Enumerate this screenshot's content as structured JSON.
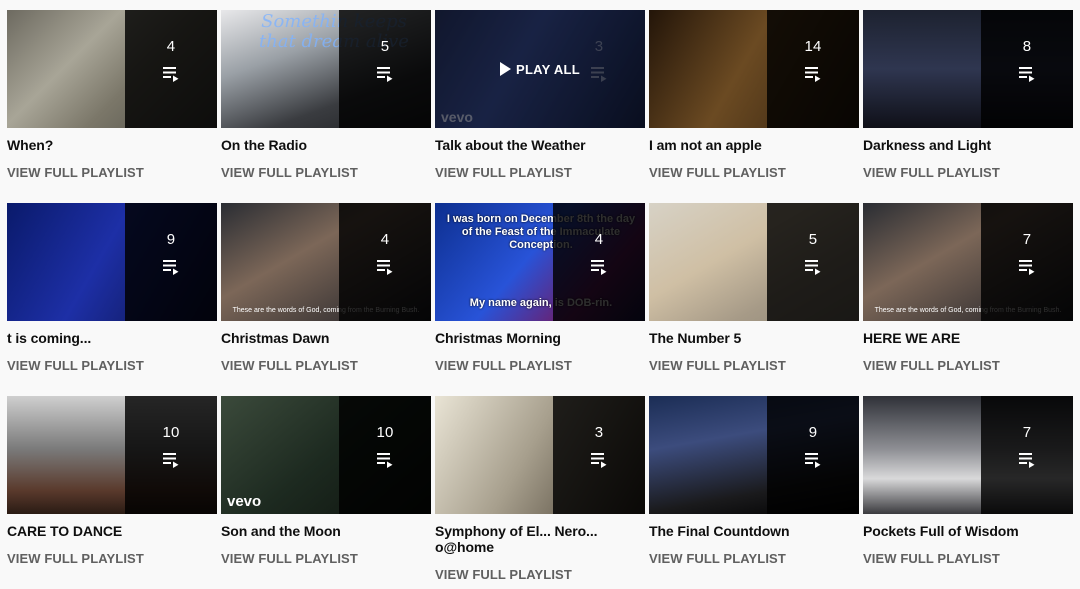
{
  "playlists": [
    {
      "title": "When?",
      "count": "4",
      "link": "VIEW FULL PLAYLIST",
      "bg": "linear-gradient(135deg,#6d6a60 0%,#a8a597 35%,#7b7769 60%,#4b4a44 100%)"
    },
    {
      "title": "On the Radio",
      "count": "5",
      "link": "VIEW FULL PLAYLIST",
      "bg": "linear-gradient(160deg,#e8e8ea 0%,#9aa0a6 35%,#3a3c40 70%,#1e1f22 100%)"
    },
    {
      "title": "Talk about the Weather",
      "count": "3",
      "link": "VIEW FULL PLAYLIST",
      "play_all": "PLAY ALL",
      "bg": "linear-gradient(120deg,#1f2a52 0%,#2d3f7c 40%,#111a38 100%)"
    },
    {
      "title": "I am not an apple",
      "count": "14",
      "link": "VIEW FULL PLAYLIST",
      "bg": "linear-gradient(120deg,#231509 0%,#6b4a22 45%,#30200f 100%)"
    },
    {
      "title": "Darkness and Light",
      "count": "8",
      "link": "VIEW FULL PLAYLIST",
      "bg": "linear-gradient(180deg,#1d2230 0%,#2f3650 50%,#0f1018 100%)"
    },
    {
      "title": "t is coming...",
      "count": "9",
      "link": "VIEW FULL PLAYLIST",
      "bg": "linear-gradient(120deg,#0a1a6b 0%,#1d2fa6 45%,#0b1040 100%)"
    },
    {
      "title": "Christmas Dawn",
      "count": "4",
      "link": "VIEW FULL PLAYLIST",
      "bg": "linear-gradient(150deg,#2a2d33 0%,#7c6758 40%,#1c1e25 100%)"
    },
    {
      "title": "Christmas Morning",
      "count": "4",
      "link": "VIEW FULL PLAYLIST",
      "bg": "linear-gradient(130deg,#0d2f8f 0%,#2853d8 45%,#6e1d6a 75%,#161b4a 100%)"
    },
    {
      "title": "The Number 5",
      "count": "5",
      "link": "VIEW FULL PLAYLIST",
      "bg": "linear-gradient(150deg,#d7d2c6 0%,#cfbfa4 40%,#a69a87 70%,#8d8676 100%)"
    },
    {
      "title": "HERE WE ARE",
      "count": "7",
      "link": "VIEW FULL PLAYLIST",
      "bg": "linear-gradient(150deg,#2a2d33 0%,#7c6758 40%,#1c1e25 100%)"
    },
    {
      "title": "CARE TO DANCE",
      "count": "10",
      "link": "VIEW FULL PLAYLIST",
      "bg": "linear-gradient(180deg,#cfcfcf 0%,#7a7a7a 45%,#5a3a2c 80%,#2a1b14 100%)"
    },
    {
      "title": "Son and the Moon",
      "count": "10",
      "link": "VIEW FULL PLAYLIST",
      "bg": "linear-gradient(140deg,#3b4a3b 0%,#1d2a20 50%,#0d120d 100%)"
    },
    {
      "title": "Symphony of El... Nero... o@home",
      "count": "3",
      "link": "VIEW FULL PLAYLIST",
      "bg": "linear-gradient(120deg,#e9e4d5 0%,#a79f8d 45%,#3b3226 100%)"
    },
    {
      "title": "The Final Countdown",
      "count": "9",
      "link": "VIEW FULL PLAYLIST",
      "bg": "linear-gradient(170deg,#1b2d55 0%,#3c4c7d 35%,#1a1a1c 75%,#000 100%)"
    },
    {
      "title": "Pockets Full of Wisdom",
      "count": "7",
      "link": "VIEW FULL PLAYLIST",
      "bg": "linear-gradient(180deg,#2f3138 0%,#8e8f94 45%,#d9d9da 70%,#3a3a3e 100%)"
    }
  ],
  "thumb_texts": {
    "radio_lyric": "Somethin keeps that dream alive",
    "christmas_dawn_caption": "These are the words of God, coming from the Burning Bush.",
    "christmas_morning_top": "I was born on December 8th the day of the Feast of the Immaculate Conception.",
    "christmas_morning_bottom": "My name again, is DOB-rin.",
    "here_we_are_caption": "These are the words of God, coming from the Burning Bush.",
    "vevo_1": "vevo",
    "vevo_2": "vevo"
  },
  "icons": {
    "queue": "playlist-queue-icon",
    "play": "play-icon"
  }
}
